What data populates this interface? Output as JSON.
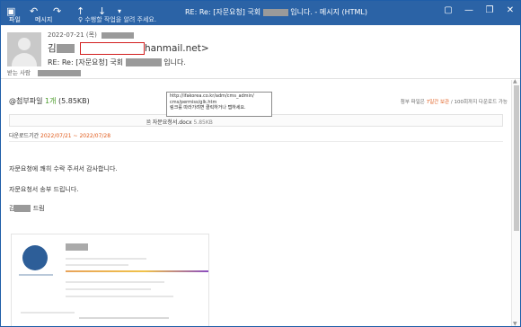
{
  "window": {
    "title_prefix": "RE: Re: [자문요청] 국회",
    "title_suffix": "입니다. - 메시지 (HTML)",
    "window_buttons": [
      "?",
      "▢",
      "—",
      "❐",
      "✕"
    ]
  },
  "menu": {
    "file": "파일",
    "message": "메시지",
    "help_hint": "♀ 수행할 작업을 알려 주세요."
  },
  "header": {
    "date": "2022-07-21 (목)",
    "sender_initial": "김",
    "sender_email_tail": "hanmail.net>",
    "subject_prefix": "RE: Re: [자문요청] 국회",
    "subject_suffix": "입니다.",
    "recipients_label": "받는 사람"
  },
  "attachment": {
    "label_prefix": "@첨부파일",
    "count": "1개",
    "size": "(5.85KB)",
    "note_prefix": "첨부 파일은",
    "note_days": "7일간 보관",
    "note_suffix": "/ 100회까지 다운로드 가능",
    "file_name": "자문요청서.docx",
    "file_size": "5.85KB",
    "download_label": "다운로드기간",
    "download_range": "2022/07/21 ~ 2022/07/28"
  },
  "tooltip": {
    "url_line1": "http://ifakorea.co.kr/adm/cms_admin/",
    "url_line2": "cms/permiss/glk.htm",
    "hint": "링크를 따라가려면 클릭하거나 탭하세요."
  },
  "body": {
    "line1": "자문요청에 쾌히 수락 주셔서 감사합니다.",
    "line2": "자문요청서 송부 드립니다.",
    "sign_initial": "김",
    "sign_suffix": "드림"
  },
  "colors": {
    "titlebar": "#2b63a6",
    "accent_orange": "#e05a1a",
    "accent_green": "#4a9b2a"
  }
}
